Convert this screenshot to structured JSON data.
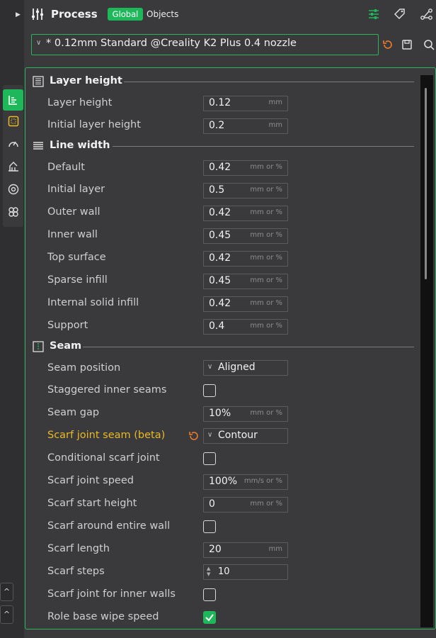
{
  "header": {
    "title": "Process",
    "toggle_global": "Global",
    "toggle_objects": "Objects"
  },
  "preset": {
    "name": "* 0.12mm Standard @Creality K2 Plus 0.4 nozzle"
  },
  "colors": {
    "accent": "#1eb85a",
    "warning": "#e9b926",
    "reset": "#f07c2a"
  },
  "sections": {
    "layer_height": {
      "title": "Layer height"
    },
    "line_width": {
      "title": "Line width"
    },
    "seam": {
      "title": "Seam"
    }
  },
  "rows": {
    "layer_height": {
      "label": "Layer height",
      "value": "0.12",
      "unit": "mm"
    },
    "initial_layer_height": {
      "label": "Initial layer height",
      "value": "0.2",
      "unit": "mm"
    },
    "default": {
      "label": "Default",
      "value": "0.42",
      "unit": "mm or %"
    },
    "initial_layer": {
      "label": "Initial layer",
      "value": "0.5",
      "unit": "mm or %"
    },
    "outer_wall": {
      "label": "Outer wall",
      "value": "0.42",
      "unit": "mm or %"
    },
    "inner_wall": {
      "label": "Inner wall",
      "value": "0.45",
      "unit": "mm or %"
    },
    "top_surface": {
      "label": "Top surface",
      "value": "0.42",
      "unit": "mm or %"
    },
    "sparse_infill": {
      "label": "Sparse infill",
      "value": "0.45",
      "unit": "mm or %"
    },
    "internal_solid_infill": {
      "label": "Internal solid infill",
      "value": "0.42",
      "unit": "mm or %"
    },
    "support": {
      "label": "Support",
      "value": "0.4",
      "unit": "mm or %"
    },
    "seam_position": {
      "label": "Seam position",
      "value": "Aligned"
    },
    "staggered_inner_seams": {
      "label": "Staggered inner seams",
      "checked": false
    },
    "seam_gap": {
      "label": "Seam gap",
      "value": "10%",
      "unit": "mm or %"
    },
    "scarf_joint_seam": {
      "label": "Scarf joint seam (beta)",
      "value": "Contour"
    },
    "conditional_scarf_joint": {
      "label": "Conditional scarf joint",
      "checked": false
    },
    "scarf_joint_speed": {
      "label": "Scarf joint speed",
      "value": "100%",
      "unit": "mm/s or %"
    },
    "scarf_start_height": {
      "label": "Scarf start height",
      "value": "0",
      "unit": "mm or %"
    },
    "scarf_around_entire_wall": {
      "label": "Scarf around entire wall",
      "checked": false
    },
    "scarf_length": {
      "label": "Scarf length",
      "value": "20",
      "unit": "mm"
    },
    "scarf_steps": {
      "label": "Scarf steps",
      "value": "10"
    },
    "scarf_joint_inner_walls": {
      "label": "Scarf joint for inner walls",
      "checked": false
    },
    "role_base_wipe_speed": {
      "label": "Role base wipe speed",
      "checked": true
    }
  },
  "icons": {
    "header": "process-sliders-icon",
    "side_tabs": [
      "quality-icon",
      "strength-icon",
      "speed-icon",
      "support-icon",
      "multimaterial-icon",
      "others-icon"
    ],
    "header_right": [
      "list-icon",
      "tag-icon",
      "connect-icon"
    ],
    "preset_actions": [
      "reset-icon",
      "save-icon",
      "search-icon"
    ]
  }
}
